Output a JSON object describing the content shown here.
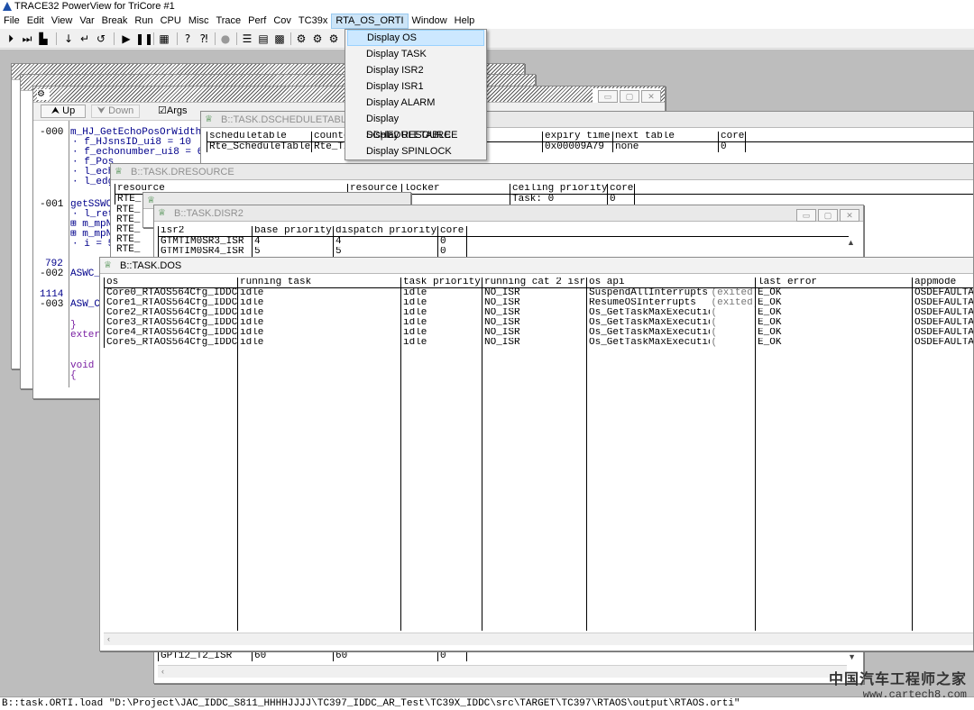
{
  "app": {
    "title": "TRACE32 PowerView for TriCore #1"
  },
  "menu": [
    "File",
    "Edit",
    "View",
    "Var",
    "Break",
    "Run",
    "CPU",
    "Misc",
    "Trace",
    "Perf",
    "Cov",
    "TC39x",
    "RTA_OS_ORTI",
    "Window",
    "Help"
  ],
  "dropdown": [
    "Display OS",
    "Display TASK",
    "Display ISR2",
    "Display ISR1",
    "Display ALARM",
    "Display SCHEDULETABLE",
    "Display RESOURCE",
    "Display SPINLOCK"
  ],
  "listwin": {
    "up": "Up",
    "down": "Down",
    "args": "Args",
    "addrs": [
      "-000",
      "-001",
      "792",
      "-002",
      "1114",
      "-003"
    ],
    "code": [
      "m_HJ_GetEchoPosOrWidth(",
      "· f_HJsnsID_ui8 = 10",
      "· f_echonumber_ui8 = 6",
      "· f_Pos",
      "· l_ech",
      "· l_edg",
      "getSSWC",
      "· l_ret",
      "⊞ m_mpN",
      "⊞ m_mpN",
      "· i = 5",
      "ASWC_",
      "ASW_C",
      "}",
      "extern",
      "void",
      "{"
    ]
  },
  "sched": {
    "title": "B::TASK.DSCHEDULETABLE",
    "headers": [
      "scheduletable",
      "counte",
      "",
      "expiry time",
      "next table",
      "core"
    ],
    "row": [
      "Rte_ScheduleTable",
      "Rte_Ti",
      "",
      "0x00009A79",
      "none",
      "0"
    ]
  },
  "resource": {
    "title": "B::TASK.DRESOURCE",
    "headers": [
      "resource",
      "resource",
      "locker",
      "ceiling priority",
      "core"
    ],
    "row": [
      "RTE_",
      "",
      "",
      "Task: 0",
      "0"
    ],
    "prefix": [
      "RTE_",
      "RTE_",
      "RTE_",
      "RTE_",
      "RTE_"
    ]
  },
  "isr2": {
    "title": "B::TASK.DISR2",
    "headers": [
      "isr2",
      "base priority",
      "dispatch priority",
      "core"
    ],
    "rows": [
      [
        "GTMTIM0SR3_ISR",
        "4",
        "4",
        "0"
      ],
      [
        "GTMTIM0SR4_ISR",
        "5",
        "5",
        "0"
      ]
    ],
    "bottom": [
      "GPT12_T2_ISR",
      "60",
      "60",
      "0"
    ]
  },
  "dos": {
    "title": "B::TASK.DOS",
    "headers": [
      "os",
      "running task",
      "task priority",
      "running cat 2 isr",
      "os api",
      "last error",
      "appmode"
    ],
    "rows": [
      [
        "Core0_RTAOS564Cfg_IDDC",
        "idle",
        "idle",
        "NO_ISR",
        "SuspendAllInterrupts",
        "(exited",
        "E_OK",
        "OSDEFAULTAP"
      ],
      [
        "Core1_RTAOS564Cfg_IDDC",
        "idle",
        "idle",
        "NO_ISR",
        "ResumeOSInterrupts",
        "(exited)",
        "E_OK",
        "OSDEFAULTAP"
      ],
      [
        "Core2_RTAOS564Cfg_IDDC",
        "idle",
        "idle",
        "NO_ISR",
        "Os_GetTaskMaxExecutionTime",
        "(",
        "E_OK",
        "OSDEFAULTAP"
      ],
      [
        "Core3_RTAOS564Cfg_IDDC",
        "idle",
        "idle",
        "NO_ISR",
        "Os_GetTaskMaxExecutionTime",
        "(",
        "E_OK",
        "OSDEFAULTAP"
      ],
      [
        "Core4_RTAOS564Cfg_IDDC",
        "idle",
        "idle",
        "NO_ISR",
        "Os_GetTaskMaxExecutionTime",
        "(",
        "E_OK",
        "OSDEFAULTAP"
      ],
      [
        "Core5_RTAOS564Cfg_IDDC",
        "idle",
        "idle",
        "NO_ISR",
        "Os_GetTaskMaxExecutionTime",
        "(",
        "E_OK",
        "OSDEFAULTAP"
      ]
    ]
  },
  "cmdline": "B::task.ORTI.load \"D:\\Project\\JAC_IDDC_S811_HHHHJJJJ\\TC397_IDDC_AR_Test\\TC39X_IDDC\\src\\TARGET\\TC397\\RTAOS\\output\\RTAOS.orti\"",
  "watermark": {
    "line1": "中国汽车工程师之家",
    "line2": "www.cartech8.com"
  },
  "colors": {
    "menu_highlight": "#cce4f7",
    "source_blue": "#00008b",
    "icon_green": "#2e7d32"
  }
}
